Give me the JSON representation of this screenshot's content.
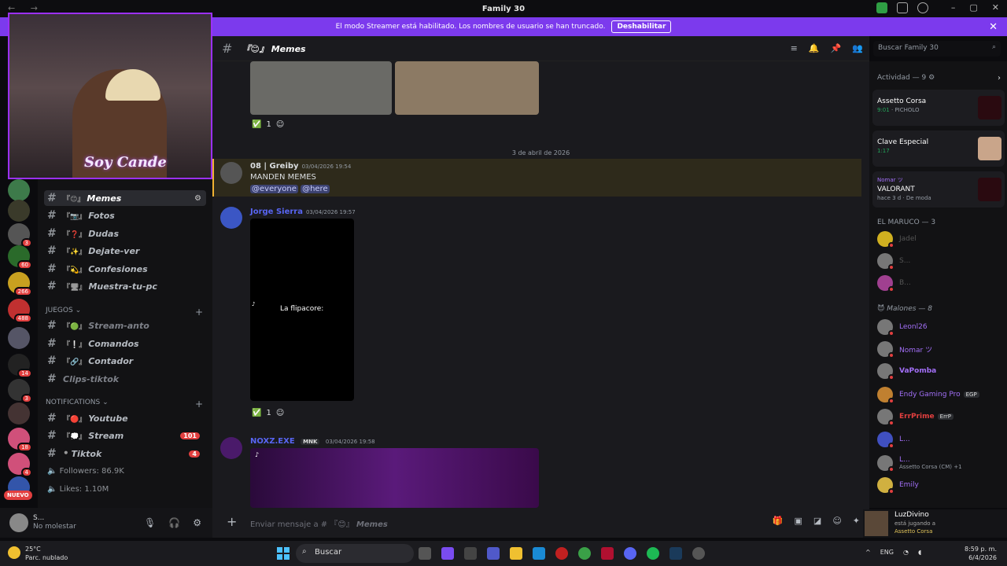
{
  "window": {
    "title": "Family 30"
  },
  "banner": {
    "text": "El modo Streamer está habilitado. Los nombres de usuario se han truncado.",
    "button": "Deshabilitar"
  },
  "server_badges": [
    "3",
    "60",
    "266",
    "488",
    "14",
    "3",
    "18",
    "4"
  ],
  "nuevo": "NUEVO",
  "webcam": {
    "overlay_text": "Soy Cande"
  },
  "channels": {
    "top": [
      {
        "emoji": "『😊』",
        "name": "Memes"
      },
      {
        "emoji": "『📷』",
        "name": "Fotos"
      },
      {
        "emoji": "『❓』",
        "name": "Dudas"
      },
      {
        "emoji": "『✨』",
        "name": "Dejate-ver"
      },
      {
        "emoji": "『💫』",
        "name": "Confesiones"
      },
      {
        "emoji": "『🖥』",
        "name": "Muestra-tu-pc"
      }
    ],
    "games_cat": "JUEGOS",
    "games": [
      {
        "emoji": "『🟢』",
        "name": "Stream-anto"
      },
      {
        "emoji": "『❕』",
        "name": "Comandos"
      },
      {
        "emoji": "『🔗』",
        "name": "Contador"
      },
      {
        "emoji": "",
        "name": "Clips-tiktok"
      }
    ],
    "notif_cat": "NOTIFICATIONS",
    "notifs": [
      {
        "emoji": "『🔴』",
        "name": "Youtube",
        "count": ""
      },
      {
        "emoji": "『💭』",
        "name": "Stream",
        "count": "101"
      },
      {
        "emoji": "⚫",
        "name": "Tiktok",
        "count": "4"
      }
    ],
    "followers": "Followers: 86.9K",
    "likes": "Likes: 1.10M"
  },
  "user": {
    "name": "S...",
    "status": "No molestar"
  },
  "chat": {
    "channel_emoji": "『😊』",
    "channel_name": "Memes",
    "search_placeholder": "Buscar Family 30",
    "reaction1_count": "1",
    "date_divider": "3 de abril de 2026",
    "msg1": {
      "author": "08 | Greiby",
      "time": "03/04/2026 19:54",
      "text": "MANDEN MEMES",
      "mention1": "@everyone",
      "mention2": "@here"
    },
    "msg2": {
      "author": "Jorge Sierra",
      "time": "03/04/2026 19:57",
      "video_caption": "La flipacore:",
      "reaction_count": "1"
    },
    "msg3": {
      "author": "NOXZ.EXE",
      "time": "03/04/2026 19:58",
      "tag": "MNK"
    },
    "composer_prefix": "Enviar mensaje a #",
    "composer_emoji": "『😊』",
    "composer_channel": "Memes"
  },
  "members": {
    "activity_header": "Actividad — 9",
    "activities": [
      {
        "game": "Assetto Corsa",
        "time": "9:01",
        "extra": "PICHOLO"
      },
      {
        "game": "Clave Especial",
        "time": "1:17",
        "extra": ""
      },
      {
        "name": "Nomar ツ",
        "game": "VALORANT",
        "time": "hace 3 d",
        "extra": "De moda"
      }
    ],
    "group1": "EL MARUCO — 3",
    "group1_members": [
      "Jadel",
      "S...",
      "B..."
    ],
    "group2": "Malones — 8",
    "group2_members": [
      {
        "name": "Leonl26",
        "sub": "",
        "tag": ""
      },
      {
        "name": "Nomar ツ",
        "sub": "",
        "tag": ""
      },
      {
        "name": "VaPomba",
        "sub": "",
        "tag": ""
      },
      {
        "name": "Endy Gaming Pro",
        "sub": "",
        "tag": "EGP"
      },
      {
        "name": "ErrPrime",
        "sub": "",
        "tag": "ErrP"
      },
      {
        "name": "L...",
        "sub": "",
        "tag": ""
      },
      {
        "name": "L...",
        "sub": "Assetto Corsa (CM) +1",
        "tag": ""
      },
      {
        "name": "Emily",
        "sub": "",
        "tag": ""
      }
    ]
  },
  "now_playing": {
    "name": "LuzDivino",
    "status": "está jugando a",
    "game": "Assetto Corsa"
  },
  "taskbar": {
    "temp": "25°C",
    "weather": "Parc. nublado",
    "search": "Buscar",
    "lang": "ENG",
    "time": "8:59 p. m.",
    "date": "6/4/2026"
  }
}
